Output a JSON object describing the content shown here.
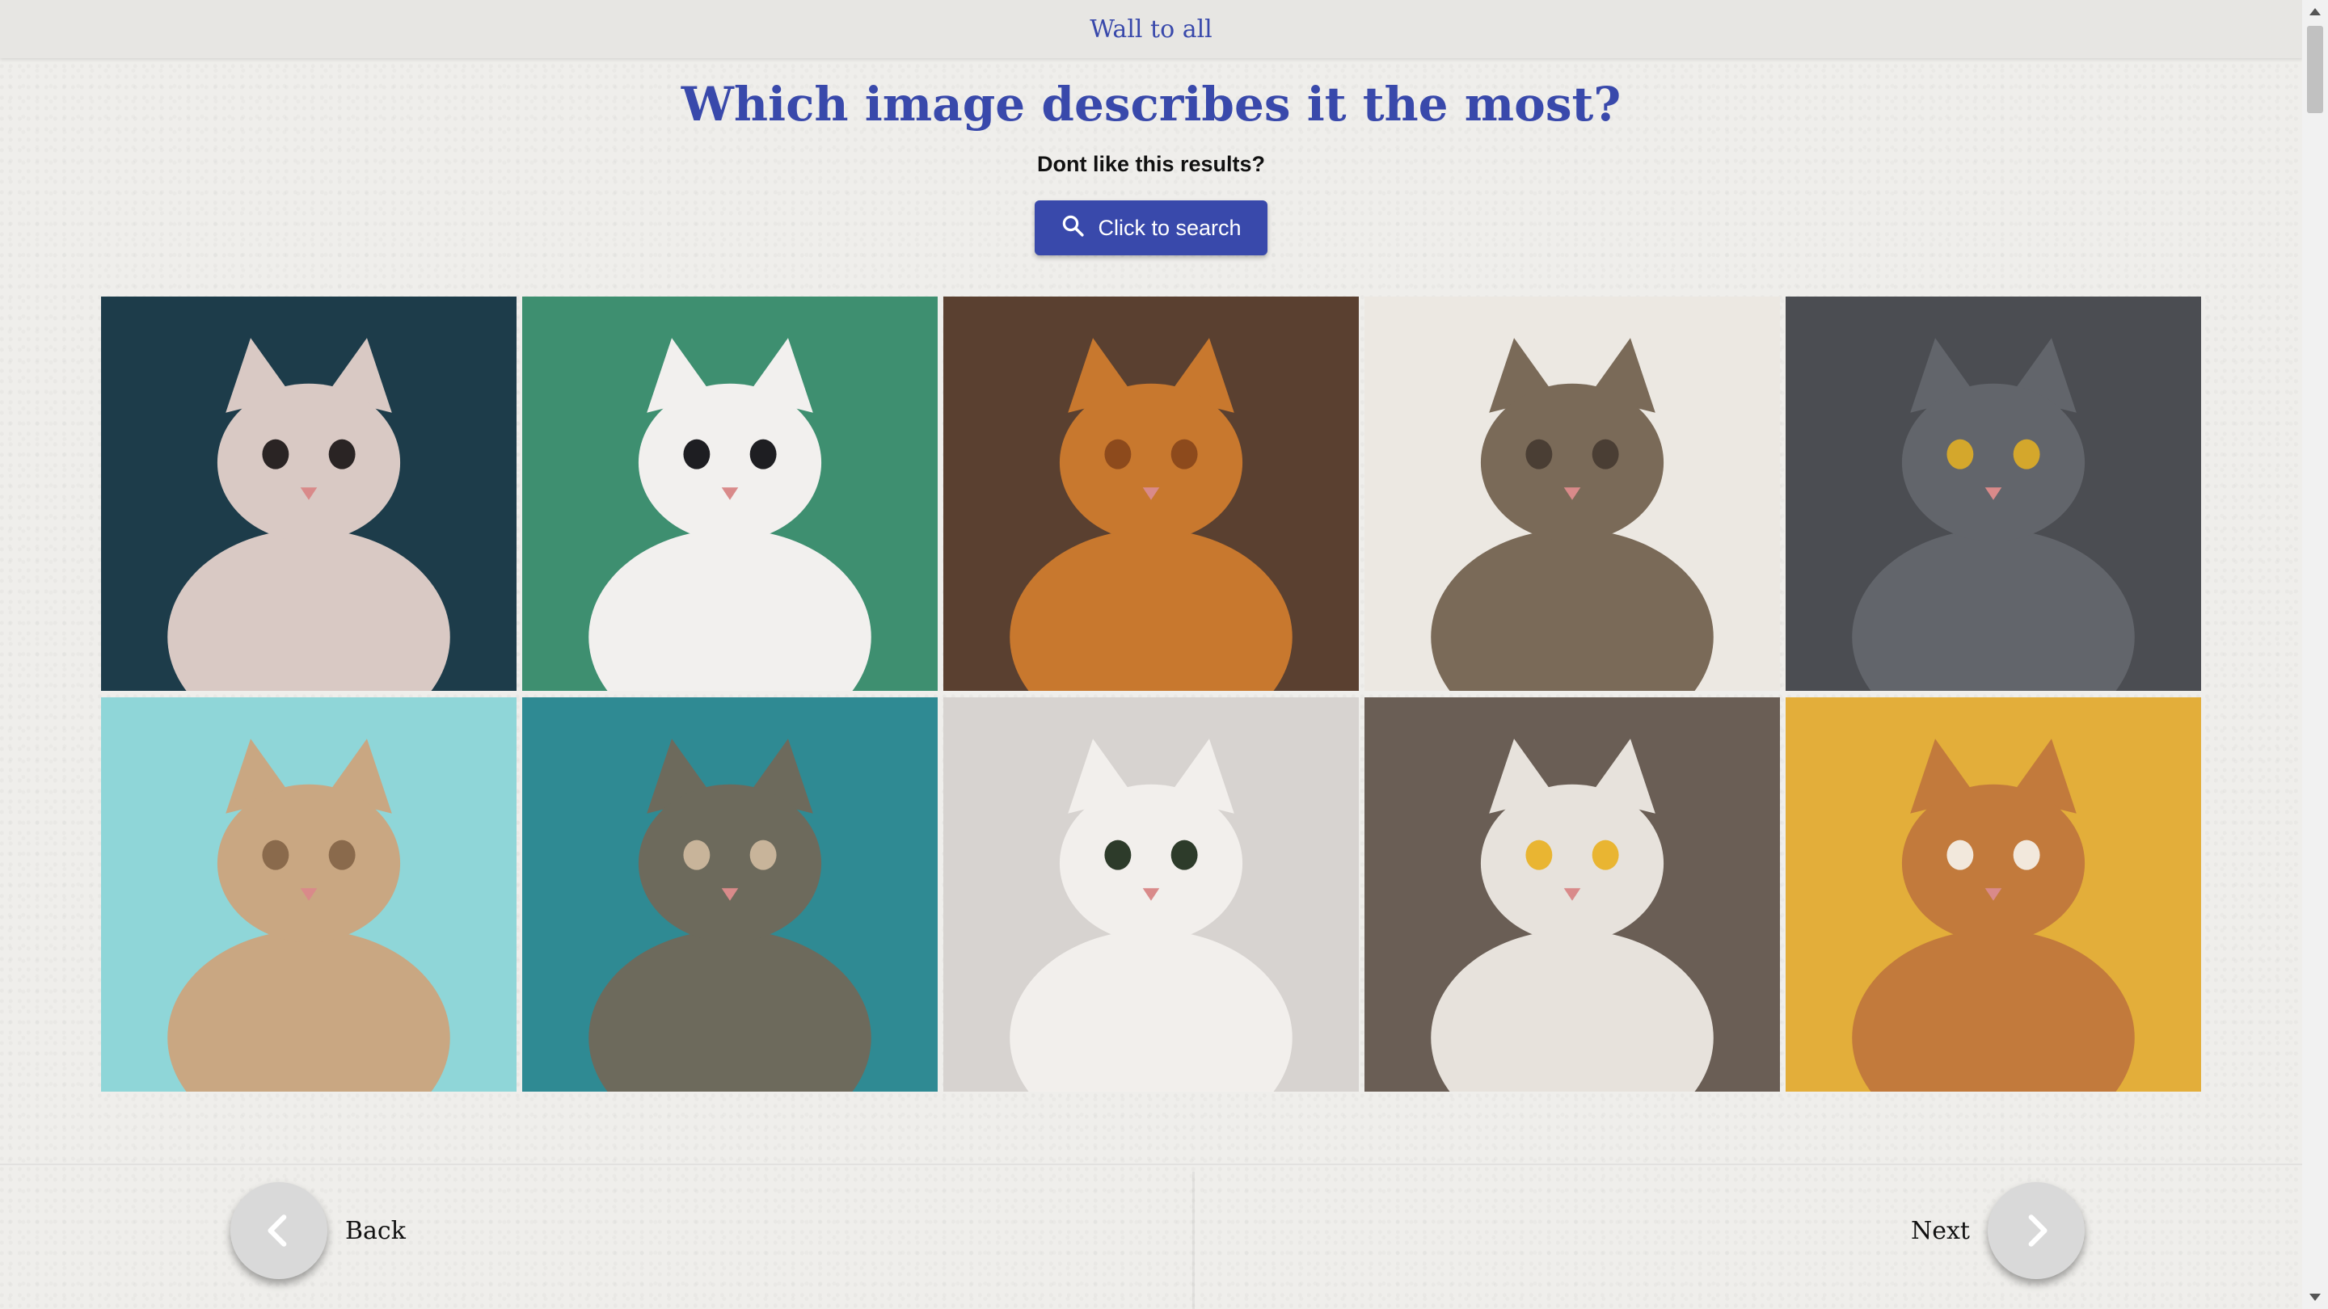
{
  "header": {
    "link_text": "Wall to all"
  },
  "title": "Which image describes it the most?",
  "subtitle": "Dont like this results?",
  "search_button": {
    "label": "Click to search",
    "icon": "search-icon"
  },
  "images": [
    {
      "name": "cat-with-butterfly-image",
      "bg": "#1d3c4a",
      "body": "#d9c9c4",
      "accent": "#2a2424"
    },
    {
      "name": "black-white-cat-green-image",
      "bg": "#3e8f70",
      "body": "#f2f0ee",
      "accent": "#1e1e22"
    },
    {
      "name": "orange-fluffy-cat-image",
      "bg": "#5a4030",
      "body": "#c8782e",
      "accent": "#8d4a1c"
    },
    {
      "name": "tabby-cat-on-stairs-image",
      "bg": "#ece8e2",
      "body": "#7a6a58",
      "accent": "#4a3e34"
    },
    {
      "name": "gray-cat-sunglasses-image",
      "bg": "#4b4d52",
      "body": "#62656b",
      "accent": "#d4a72c"
    },
    {
      "name": "kitten-reaching-up-image",
      "bg": "#8fd6d8",
      "body": "#c9a782",
      "accent": "#8a6a4c"
    },
    {
      "name": "tabby-cat-peeking-image",
      "bg": "#2f8a93",
      "body": "#6d6a5c",
      "accent": "#c8b49a"
    },
    {
      "name": "surprised-white-cat-image",
      "bg": "#d7d3d0",
      "body": "#f2efec",
      "accent": "#2d3b2a"
    },
    {
      "name": "happy-cat-bandana-image",
      "bg": "#6a5e55",
      "body": "#e7e2dc",
      "accent": "#e9b532"
    },
    {
      "name": "ginger-cat-yellow-image",
      "bg": "#e3ae3a",
      "body": "#c27a3c",
      "accent": "#f2e8dc"
    }
  ],
  "nav": {
    "back_label": "Back",
    "next_label": "Next"
  },
  "colors": {
    "primary": "#3949ab",
    "background": "#efeeeb"
  }
}
